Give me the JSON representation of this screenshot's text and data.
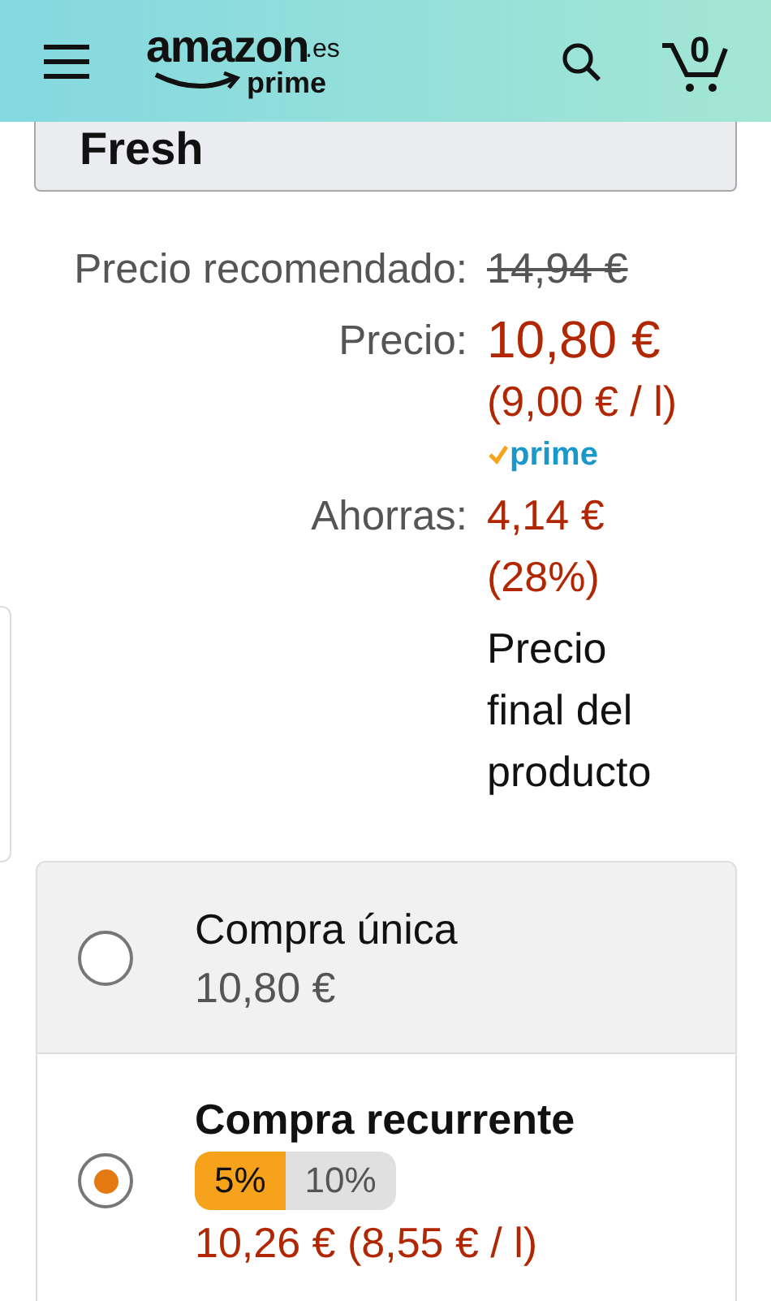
{
  "header": {
    "logo": {
      "word": "amazon",
      "domain": ".es",
      "tier": "prime"
    },
    "cart_count": "0"
  },
  "category_button": {
    "label": "Fresh"
  },
  "prices": [
    {
      "label": "Precio recomendado:",
      "kind": "struck",
      "lines": [
        "14,94 €"
      ]
    },
    {
      "label": "Precio:",
      "kind": "main",
      "lines": [
        "10,80 €",
        "(9,00 € / l)"
      ],
      "prime": "prime"
    },
    {
      "label": "Ahorras:",
      "kind": "saving",
      "lines": [
        "4,14 €",
        "(28%)"
      ]
    },
    {
      "kind": "note",
      "lines": [
        "Precio",
        "final del",
        "producto"
      ]
    }
  ],
  "purchase_options": [
    {
      "title": "Compra única",
      "price": "10,80 €",
      "selected": false
    },
    {
      "title": "Compra recurrente",
      "price": "10,26 € (8,55 € / l)",
      "selected": true,
      "tiers": [
        {
          "label": "5%",
          "selected": true
        },
        {
          "label": "10%",
          "selected": false
        }
      ]
    }
  ]
}
